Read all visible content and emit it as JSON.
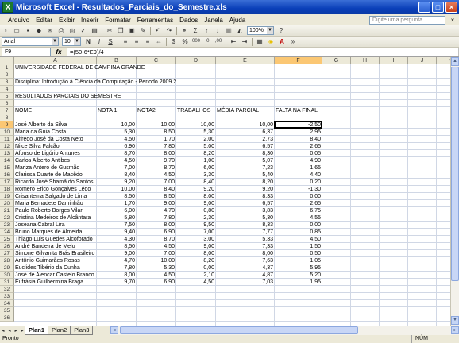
{
  "window": {
    "title": "Microsoft Excel - Resultados_Parciais_do_Semestre.xls",
    "app_icon": "excel-icon"
  },
  "menu": {
    "items": [
      "Arquivo",
      "Editar",
      "Exibir",
      "Inserir",
      "Formatar",
      "Ferramentas",
      "Dados",
      "Janela",
      "Ajuda"
    ],
    "help_placeholder": "Digite uma pergunta"
  },
  "toolbar": {
    "zoom": "100%",
    "font_name": "Arial",
    "font_size": "10",
    "bold": "N",
    "italic": "I",
    "underline": "S",
    "sum": "Σ",
    "currency": "%",
    "thousands": "000",
    "dec_inc": ",0",
    "dec_dec": ",00"
  },
  "formula_bar": {
    "name_box": "F9",
    "fx": "fx",
    "formula": "=(50-6*E9)/4"
  },
  "columns": [
    "A",
    "B",
    "C",
    "D",
    "E",
    "F",
    "G",
    "H",
    "I",
    "J",
    "K"
  ],
  "selected": {
    "column": "F",
    "row": 9
  },
  "rows": [
    {
      "n": 1,
      "a": "UNIVERSIDADE FEDERAL DE CAMPINA GRANDE"
    },
    {
      "n": 2
    },
    {
      "n": 3,
      "a": "Disciplina: Introdução à Ciência da Computação - Periodo 2009.2"
    },
    {
      "n": 4
    },
    {
      "n": 5,
      "a": "RESULTADOS PARCIAIS DO SEMESTRE"
    },
    {
      "n": 6
    },
    {
      "n": 7,
      "a": "NOME",
      "b": "NOTA 1",
      "c": "NOTA2",
      "d": "TRABALHOS",
      "e": "MÉDIA PARCIAL",
      "f": "FALTA NA FINAL"
    },
    {
      "n": 8
    },
    {
      "n": 9,
      "a": "José Alberto da Silva",
      "b": "10,00",
      "c": "10,00",
      "d": "10,00",
      "e": "10,00",
      "f": "-2,50"
    },
    {
      "n": 10,
      "a": "Maria da Guia Costa",
      "b": "5,30",
      "c": "8,50",
      "d": "5,30",
      "e": "6,37",
      "f": "2,95"
    },
    {
      "n": 11,
      "a": "Alfredo José da Costa Neto",
      "b": "4,50",
      "c": "1,70",
      "d": "2,00",
      "e": "2,73",
      "f": "8,40"
    },
    {
      "n": 12,
      "a": "Nilce Silva Falcão",
      "b": "6,90",
      "c": "7,80",
      "d": "5,00",
      "e": "6,57",
      "f": "2,65"
    },
    {
      "n": 13,
      "a": "Afonso de Ligório Antunes",
      "b": "8,70",
      "c": "8,00",
      "d": "8,20",
      "e": "8,30",
      "f": "0,05"
    },
    {
      "n": 14,
      "a": "Carlos Alberto Antibes",
      "b": "4,50",
      "c": "9,70",
      "d": "1,00",
      "e": "5,07",
      "f": "4,90"
    },
    {
      "n": 15,
      "a": "Mariza Antero de Gusmão",
      "b": "7,00",
      "c": "8,70",
      "d": "6,00",
      "e": "7,23",
      "f": "1,65"
    },
    {
      "n": 16,
      "a": "Clarissa Duarte de Macêdo",
      "b": "8,40",
      "c": "4,50",
      "d": "3,30",
      "e": "5,40",
      "f": "4,40"
    },
    {
      "n": 17,
      "a": "Ricardo José Shamã do Santos",
      "b": "9,20",
      "c": "7,00",
      "d": "8,40",
      "e": "8,20",
      "f": "0,20"
    },
    {
      "n": 18,
      "a": "Romero Erico Gonçalves Lêdo",
      "b": "10,00",
      "c": "8,40",
      "d": "9,20",
      "e": "9,20",
      "f": "-1,30"
    },
    {
      "n": 19,
      "a": "Crisantema Salgado de Lima",
      "b": "8,50",
      "c": "8,50",
      "d": "8,00",
      "e": "8,33",
      "f": "0,00"
    },
    {
      "n": 20,
      "a": "Maria Bernadete Daminhão",
      "b": "1,70",
      "c": "9,00",
      "d": "9,00",
      "e": "6,57",
      "f": "2,65"
    },
    {
      "n": 21,
      "a": "Paulo Roberto Borges Vilar",
      "b": "6,00",
      "c": "4,70",
      "d": "0,80",
      "e": "3,83",
      "f": "6,75"
    },
    {
      "n": 22,
      "a": "Cristina Medeiros de Alcântara",
      "b": "5,80",
      "c": "7,80",
      "d": "2,30",
      "e": "5,30",
      "f": "4,55"
    },
    {
      "n": 23,
      "a": "Joseana Cabral Lira",
      "b": "7,50",
      "c": "8,00",
      "d": "9,50",
      "e": "8,33",
      "f": "0,00"
    },
    {
      "n": 24,
      "a": "Bruno Marques de Almeida",
      "b": "9,40",
      "c": "6,90",
      "d": "7,00",
      "e": "7,77",
      "f": "0,85"
    },
    {
      "n": 25,
      "a": "Thiago Luis Guedes Alcoforado",
      "b": "4,30",
      "c": "8,70",
      "d": "3,00",
      "e": "5,33",
      "f": "4,50"
    },
    {
      "n": 26,
      "a": "André Bandeira de Melo",
      "b": "8,50",
      "c": "4,50",
      "d": "9,00",
      "e": "7,33",
      "f": "1,50"
    },
    {
      "n": 27,
      "a": "Simone Gilvanita Brás Brasileiro",
      "b": "9,00",
      "c": "7,00",
      "d": "8,00",
      "e": "8,00",
      "f": "0,50"
    },
    {
      "n": 28,
      "a": "Antônio Guimarães Rosas",
      "b": "4,70",
      "c": "10,00",
      "d": "8,20",
      "e": "7,63",
      "f": "1,05"
    },
    {
      "n": 29,
      "a": "Euclides Tibério da Cunha",
      "b": "7,80",
      "c": "5,30",
      "d": "0,00",
      "e": "4,37",
      "f": "5,95"
    },
    {
      "n": 30,
      "a": "José de Alencar Castelo Branco",
      "b": "8,00",
      "c": "4,50",
      "d": "2,10",
      "e": "4,87",
      "f": "5,20"
    },
    {
      "n": 31,
      "a": "Eufrásia Guilhermina Braga",
      "b": "9,70",
      "c": "6,90",
      "d": "4,50",
      "e": "7,03",
      "f": "1,95"
    },
    {
      "n": 32
    },
    {
      "n": 33
    },
    {
      "n": 34
    },
    {
      "n": 35
    },
    {
      "n": 36
    }
  ],
  "sheets": [
    "Plan1",
    "Plan2",
    "Plan3"
  ],
  "active_sheet": "Plan1",
  "status": {
    "text": "Pronto",
    "mode": "NÚM"
  }
}
